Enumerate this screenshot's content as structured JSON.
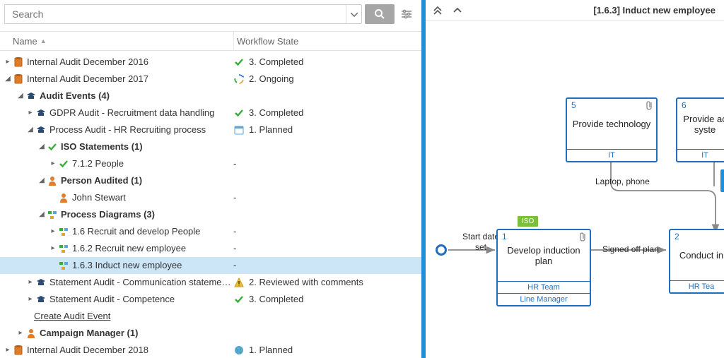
{
  "search": {
    "placeholder": "Search"
  },
  "columns": {
    "name": "Name",
    "state": "Workflow State"
  },
  "create_link": "Create Audit Event",
  "states": {
    "completed": "3. Completed",
    "ongoing": "2. Ongoing",
    "planned": "1. Planned",
    "reviewed": "2. Reviewed with comments"
  },
  "tree": {
    "r1": "Internal Audit December 2016",
    "r2": "Internal Audit December 2017",
    "r3": "Audit Events (4)",
    "r4": "GDPR Audit - Recruitment data handling",
    "r5": "Process Audit - HR Recruiting process",
    "r6": "ISO Statements (1)",
    "r7": "7.1.2 People",
    "r8": "Person Audited (1)",
    "r9": "John Stewart",
    "r10": "Process Diagrams (3)",
    "r11": "1.6 Recruit and develop People",
    "r12": "1.6.2 Recruit new employee",
    "r13": "1.6.3 Induct new employee",
    "r14": "Statement Audit - Communication statements",
    "r15": "Statement Audit - Competence",
    "r16": "Campaign Manager (1)",
    "r17": "Internal Audit December 2018"
  },
  "diagram": {
    "title": "[1.6.3] Induct new employee",
    "start_label_a": "Start date",
    "start_label_b": "set",
    "edge1": "Laptop, phone",
    "edge2": "Signed off plan",
    "iso_tag": "ISO",
    "box1": {
      "num": "1",
      "title": "Develop induction plan",
      "lane1": "HR Team",
      "lane2": "Line Manager"
    },
    "box2": {
      "num": "2",
      "title": "Conduct in",
      "lane1": "HR Tea"
    },
    "box5": {
      "num": "5",
      "title": "Provide technology",
      "lane1": "IT"
    },
    "box6": {
      "num": "6",
      "title_a": "Provide ac",
      "title_b": "syste",
      "lane1": "IT"
    }
  }
}
